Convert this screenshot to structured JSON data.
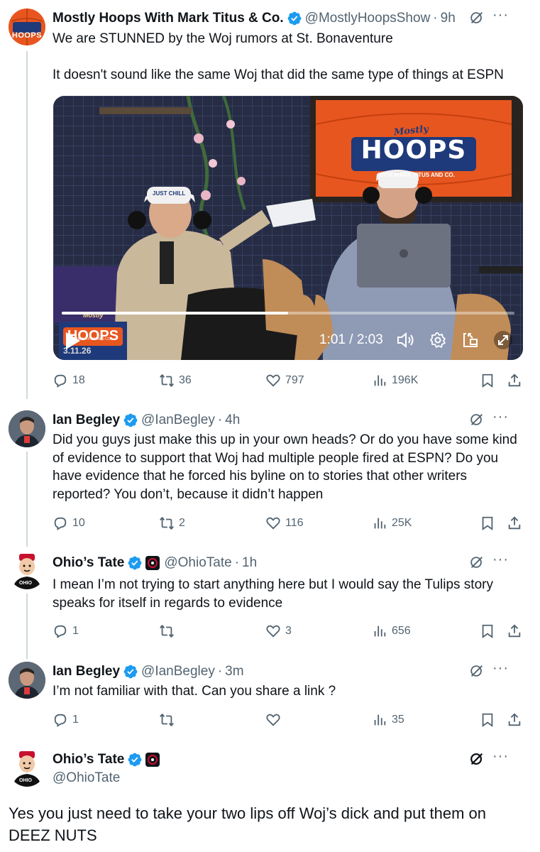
{
  "tweets": [
    {
      "name": "Mostly Hoops With Mark Titus & Co.",
      "handle": "@MostlyHoopsShow",
      "time": "9h",
      "text_line1": "We are STUNNED by the Woj rumors at St. Bonaventure",
      "text_line2": "It doesn't sound like the same Woj that did the same type of things at ESPN",
      "stats": {
        "replies": "18",
        "reposts": "36",
        "likes": "797",
        "views": "196K"
      },
      "video": {
        "time": "1:01 / 2:03",
        "progress": 0.5,
        "wall_logo_top": "Mostly",
        "wall_logo_main": "HOOPS",
        "wall_logo_sub": "WITH MARK TITUS AND CO.",
        "corner_logo_top": "Mostly",
        "corner_logo_main": "HOOPS",
        "corner_logo_sub": "MARK TITUS AND CO.",
        "corner_date": "3.11.26",
        "hat_text": "JUST CHILL"
      }
    },
    {
      "name": "Ian Begley",
      "handle": "@IanBegley",
      "time": "4h",
      "text": "Did you guys just make this up in your own heads? Or do you have some kind of evidence to support that Woj had multiple people fired at ESPN? Do you have evidence that he forced his byline on to stories that other writers reported? You don’t, because it didn’t happen",
      "stats": {
        "replies": "10",
        "reposts": "2",
        "likes": "116",
        "views": "25K"
      }
    },
    {
      "name": "Ohio’s Tate",
      "handle": "@OhioTate",
      "time": "1h",
      "text": "I mean I’m not trying to start anything here but I would say the Tulips story speaks for itself in regards to evidence",
      "stats": {
        "replies": "1",
        "reposts": "",
        "likes": "3",
        "views": "656"
      }
    },
    {
      "name": "Ian Begley",
      "handle": "@IanBegley",
      "time": "3m",
      "text": "I’m not familiar with that. Can you share a link ?",
      "stats": {
        "replies": "1",
        "reposts": "",
        "likes": "",
        "views": "35"
      }
    },
    {
      "name": "Ohio’s Tate",
      "handle": "@OhioTate",
      "text": "Yes you just need to take your two lips off Woj’s dick and put them on DEEZ NUTS"
    }
  ],
  "avatars": {
    "mostly_hoops": "HOOPS",
    "ohio_tate": "OHIO"
  },
  "colors": {
    "verified": "#1d9bf0",
    "muted": "#536471",
    "thread": "#cfd9de",
    "accent_orange": "#e8561f"
  },
  "icons": [
    "reply-icon",
    "repost-icon",
    "like-icon",
    "views-icon",
    "bookmark-icon",
    "share-icon",
    "grok-icon",
    "more-icon",
    "verified-icon"
  ]
}
